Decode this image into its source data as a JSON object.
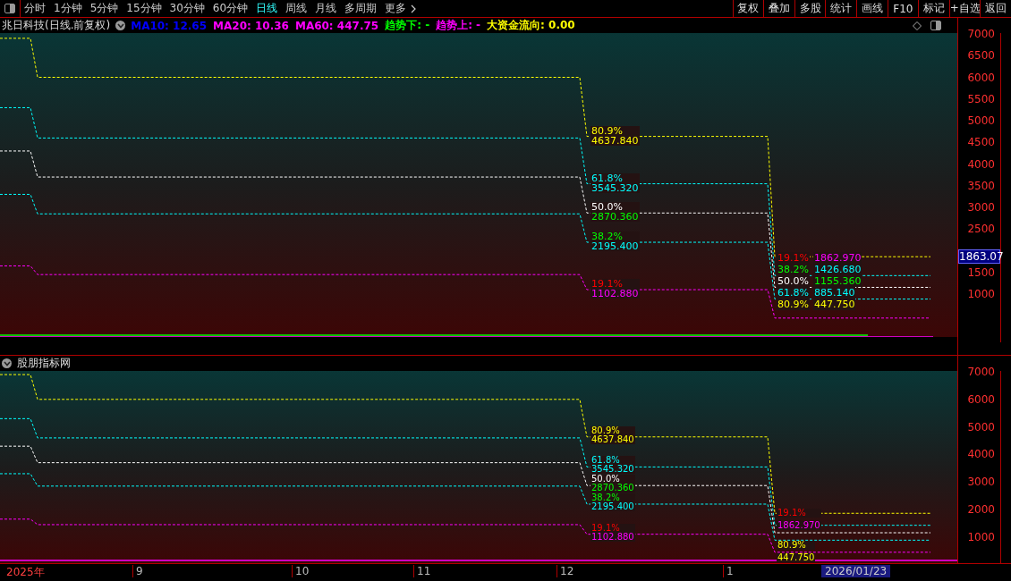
{
  "toolbar": {
    "periods": [
      {
        "label": "分时",
        "selected": false
      },
      {
        "label": "1分钟",
        "selected": false
      },
      {
        "label": "5分钟",
        "selected": false
      },
      {
        "label": "15分钟",
        "selected": false
      },
      {
        "label": "30分钟",
        "selected": false
      },
      {
        "label": "60分钟",
        "selected": false
      },
      {
        "label": "日线",
        "selected": true
      },
      {
        "label": "周线",
        "selected": false
      },
      {
        "label": "月线",
        "selected": false
      },
      {
        "label": "多周期",
        "selected": false
      },
      {
        "label": "更多",
        "selected": false
      }
    ],
    "actions": [
      "复权",
      "叠加",
      "多股",
      "统计",
      "画线",
      "F10",
      "标记",
      "+自选",
      "返回"
    ]
  },
  "main_panel": {
    "title": "兆日科技(日线.前复权)",
    "indicators": [
      {
        "text": "MA10: 12.65",
        "color": "#0000ff"
      },
      {
        "text": "MA20: 10.36",
        "color": "#ff00ff"
      },
      {
        "text": "MA60: 447.75",
        "color": "#ff00ff"
      },
      {
        "text": "趋势下: -",
        "color": "#00ff00"
      },
      {
        "text": "趋势上: -",
        "color": "#ff00ff"
      },
      {
        "text": "大资金流向: 0.00",
        "color": "#ffff00"
      }
    ],
    "y_ticks": [
      "7000",
      "6500",
      "6000",
      "5500",
      "5000",
      "4500",
      "4000",
      "3500",
      "3000",
      "2500",
      "1500",
      "1000"
    ],
    "price_tag": "1863.07",
    "fib_groups": [
      {
        "labels": [
          {
            "percent": {
              "text": "80.9%",
              "color": "#ffff00"
            },
            "value": {
              "text": "4637.840",
              "color": "#ffff00"
            }
          },
          {
            "percent": {
              "text": "61.8%",
              "color": "#00ffff"
            },
            "value": {
              "text": "3545.320",
              "color": "#00ffff"
            }
          },
          {
            "percent": {
              "text": "50.0%",
              "color": "#ffffff"
            },
            "value": {
              "text": "2870.360",
              "color": "#00ff00"
            }
          },
          {
            "percent": {
              "text": "38.2%",
              "color": "#00ff00"
            },
            "value": {
              "text": "2195.400",
              "color": "#00ffff"
            }
          },
          {
            "percent": {
              "text": "19.1%",
              "color": "#ff0000"
            },
            "value": {
              "text": "1102.880",
              "color": "#ff00ff"
            }
          }
        ]
      },
      {
        "labels": [
          {
            "percent": {
              "text": "19.1%",
              "color": "#ff0000"
            },
            "value": {
              "text": "1862.970",
              "color": "#ff00ff"
            }
          },
          {
            "percent": {
              "text": "38.2%",
              "color": "#00ff00"
            },
            "value": {
              "text": "1426.680",
              "color": "#00ffff"
            }
          },
          {
            "percent": {
              "text": "50.0%",
              "color": "#ffffff"
            },
            "value": {
              "text": "1155.360",
              "color": "#00ff00"
            }
          },
          {
            "percent": {
              "text": "61.8%",
              "color": "#00ffff"
            },
            "value": {
              "text": "885.140",
              "color": "#00ffff"
            }
          },
          {
            "percent": {
              "text": "80.9%",
              "color": "#ffff00"
            },
            "value": {
              "text": "447.750",
              "color": "#ffff00"
            }
          }
        ]
      }
    ]
  },
  "sub_panel": {
    "title": "股朋指标网",
    "y_ticks": [
      "7000",
      "6000",
      "5000",
      "4000",
      "3000",
      "2000",
      "1000"
    ],
    "fib_groups": [
      {
        "labels": [
          {
            "percent": {
              "text": "80.9%",
              "color": "#ffff00"
            },
            "value": {
              "text": "4637.840",
              "color": "#ffff00"
            }
          },
          {
            "percent": {
              "text": "61.8%",
              "color": "#00ffff"
            },
            "value": {
              "text": "3545.320",
              "color": "#00ffff"
            }
          },
          {
            "percent": {
              "text": "50.0%",
              "color": "#ffffff"
            },
            "value": {
              "text": "2870.360",
              "color": "#00ff00"
            }
          },
          {
            "percent": {
              "text": "38.2%",
              "color": "#00ff00"
            },
            "value": {
              "text": "2195.400",
              "color": "#00ffff"
            }
          },
          {
            "percent": {
              "text": "19.1%",
              "color": "#ff0000"
            },
            "value": {
              "text": "1102.880",
              "color": "#ff00ff"
            }
          }
        ]
      },
      {
        "labels": [
          {
            "percent": {
              "text": "19.1%",
              "color": "#ff0000"
            },
            "value": {
              "text": "1862.970",
              "color": "#ff00ff"
            }
          },
          {
            "percent": {
              "text": "80.9%",
              "color": "#ffff00"
            },
            "value": {
              "text": "447.750",
              "color": "#ffff00"
            }
          }
        ]
      }
    ]
  },
  "x_axis": {
    "labels": [
      "2025年",
      "9",
      "10",
      "11",
      "12",
      "1"
    ],
    "cursor_date": "2026/01/23"
  }
}
